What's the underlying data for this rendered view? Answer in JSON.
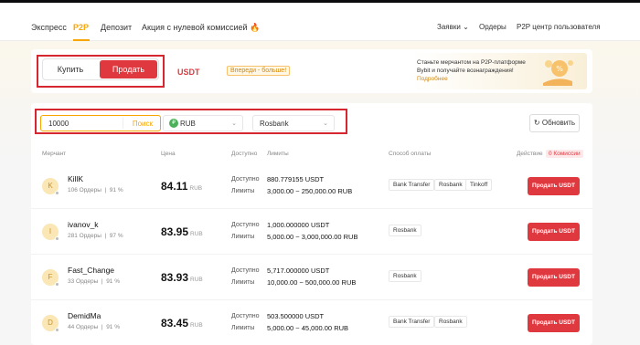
{
  "nav": {
    "items": [
      "Экспресс",
      "P2P",
      "Депозит",
      "Акция с нулевой комиссией"
    ],
    "right": [
      "Заявки",
      "Ордеры",
      "P2P центр пользователя"
    ]
  },
  "trade": {
    "buy_label": "Купить",
    "sell_label": "Продать",
    "asset": "USDT",
    "badge": "Впереди - больше!"
  },
  "banner": {
    "text": "Станьте мерчантом на P2P-платформе Bybit и получайте вознаграждения!",
    "link": "Подробнее"
  },
  "filters": {
    "amount": "10000",
    "search_label": "Поиск",
    "currency": "RUB",
    "currency_icon": "₽",
    "payment": "Rosbank",
    "refresh_label": "Обновить"
  },
  "table": {
    "headers": {
      "merchant": "Мерчант",
      "price": "Цена",
      "available": "Доступно",
      "limits": "Лимиты",
      "payment": "Способ оплаты",
      "action": "Действие",
      "commission": "0 Комиссии"
    },
    "avail_label": "Доступно",
    "limits_label": "Лимиты",
    "action_label": "Продать USDT",
    "rows": [
      {
        "initial": "K",
        "name": "KillK",
        "orders": "106 Ордеры",
        "rate": "91 %",
        "price": "84.11",
        "currency": "RUB",
        "available": "880.779155 USDT",
        "limits": "3,000.00 ~ 250,000.00 RUB",
        "payments": [
          "Bank Transfer",
          "Rosbank",
          "Tinkoff"
        ]
      },
      {
        "initial": "I",
        "name": "ivanov_k",
        "orders": "281 Ордеры",
        "rate": "97 %",
        "price": "83.95",
        "currency": "RUB",
        "available": "1,000.000000 USDT",
        "limits": "5,000.00 ~ 3,000,000.00 RUB",
        "payments": [
          "Rosbank"
        ]
      },
      {
        "initial": "F",
        "name": "Fast_Change",
        "orders": "33 Ордеры",
        "rate": "91 %",
        "price": "83.93",
        "currency": "RUB",
        "available": "5,717.000000 USDT",
        "limits": "10,000.00 ~ 500,000.00 RUB",
        "payments": [
          "Rosbank"
        ]
      },
      {
        "initial": "D",
        "name": "DemidMa",
        "orders": "44 Ордеры",
        "rate": "91 %",
        "price": "83.45",
        "currency": "RUB",
        "available": "503.500000 USDT",
        "limits": "5,000.00 ~ 45,000.00 RUB",
        "payments": [
          "Bank Transfer",
          "Rosbank"
        ]
      }
    ]
  },
  "colors": {
    "accent": "#f7a600",
    "sell": "#e0383f",
    "highlight": "#d6262f"
  }
}
